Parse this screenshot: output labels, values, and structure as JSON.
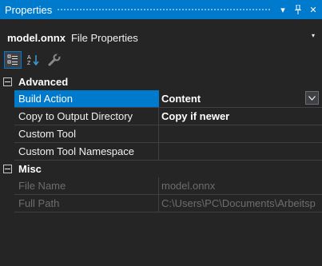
{
  "window": {
    "title": "Properties",
    "pin_glyph": "¶",
    "close_glyph": "✕",
    "dropdown_glyph": "▾"
  },
  "object": {
    "name": "model.onnx",
    "type": "File Properties",
    "caret_glyph": "▾"
  },
  "toolbar": [
    {
      "icon": "categorized-icon",
      "active": true
    },
    {
      "icon": "alphabetical-icon",
      "active": false
    },
    {
      "icon": "property-pages-icon",
      "active": false
    }
  ],
  "categories": [
    {
      "name": "Advanced",
      "properties": [
        {
          "name": "Build Action",
          "value": "Content"
        },
        {
          "name": "Copy to Output Directory",
          "value": "Copy if newer"
        },
        {
          "name": "Custom Tool",
          "value": ""
        },
        {
          "name": "Custom Tool Namespace",
          "value": ""
        }
      ]
    },
    {
      "name": "Misc",
      "properties": [
        {
          "name": "File Name",
          "value": "model.onnx"
        },
        {
          "name": "Full Path",
          "value": "C:\\Users\\PC\\Documents\\Arbeitsp"
        }
      ]
    }
  ],
  "colors": {
    "accent": "#007acc",
    "background": "#252526",
    "grid_line": "#3f3f46",
    "disabled_text": "#6d6d6d"
  }
}
